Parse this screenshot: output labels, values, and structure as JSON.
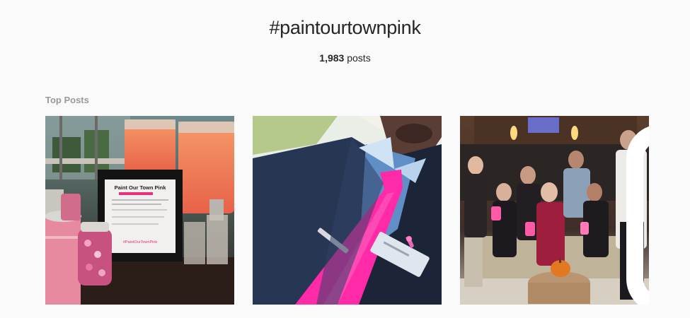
{
  "header": {
    "hashtag": "#paintourtownpink",
    "post_count": "1,983",
    "post_count_suffix": " posts"
  },
  "top_posts": {
    "label": "Top Posts",
    "posts": [
      {
        "sign_title": "Paint Our Town Pink",
        "sign_footer": "#PaintOurTownPink"
      },
      {},
      {
        "badge_icon": "camera-icon"
      }
    ]
  },
  "colors": {
    "background": "#fafafa",
    "text": "#262626",
    "muted": "#999999",
    "tie_pink": "#ff2aa8",
    "accent_pink": "#e8317a"
  }
}
